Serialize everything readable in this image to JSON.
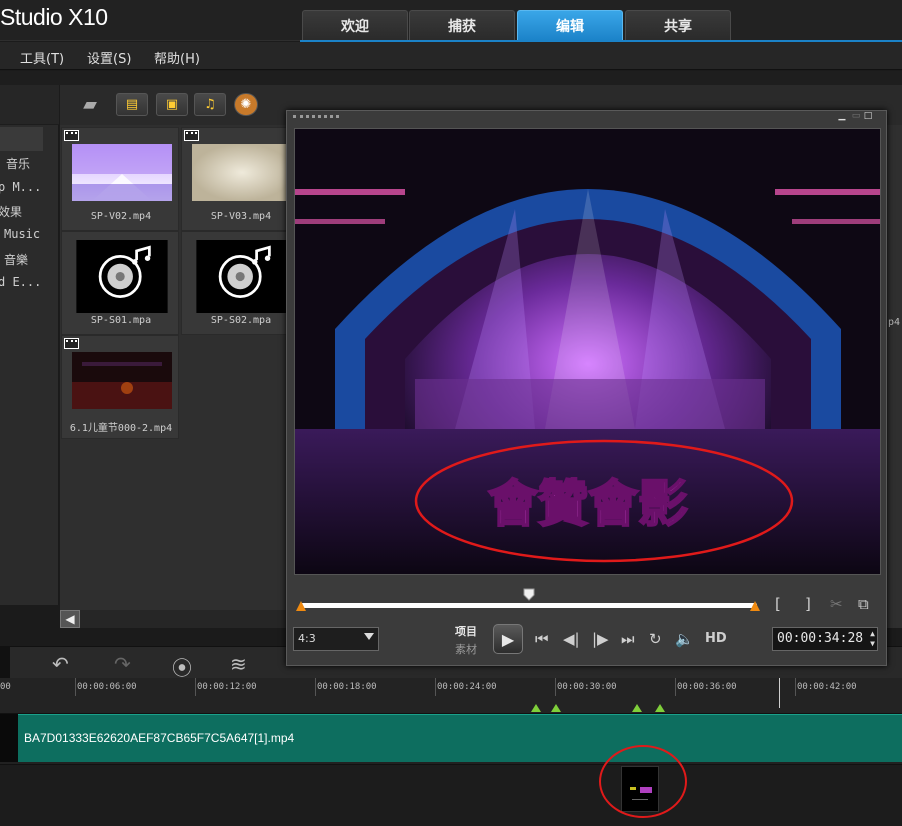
{
  "app": {
    "title": "Studio X10"
  },
  "mode_tabs": [
    {
      "label": "欢迎",
      "active": false
    },
    {
      "label": "捕获",
      "active": false
    },
    {
      "label": "编辑",
      "active": true
    },
    {
      "label": "共享",
      "active": false
    }
  ],
  "menu": [
    {
      "label": "工具(T)"
    },
    {
      "label": "设置(S)"
    },
    {
      "label": "帮助(H)"
    }
  ],
  "categories": [
    {
      "label": "音乐"
    },
    {
      "label": "p M..."
    },
    {
      "label": "效果"
    },
    {
      "label": "Music"
    },
    {
      "label": "音樂"
    },
    {
      "label": "d E..."
    }
  ],
  "library_tiles": [
    {
      "name": "SP-V02.mp4",
      "kind": "video"
    },
    {
      "name": "SP-V03.mp4",
      "kind": "video"
    },
    {
      "name": "SP-S01.mpa",
      "kind": "audio"
    },
    {
      "name": "SP-S02.mpa",
      "kind": "audio"
    },
    {
      "name": "6.1儿童节000-2.mp4",
      "kind": "video"
    }
  ],
  "library_side_label": "p4",
  "preview": {
    "aspect": "4:3",
    "mode_project": "项目",
    "mode_clip": "素材",
    "hd_label": "HD",
    "timecode": "00:00:34:28",
    "scrub_position": 0.5,
    "watermark_text": "會贊會影"
  },
  "ruler_ticks": [
    "00",
    "00:00:06:00",
    "00:00:12:00",
    "00:00:18:00",
    "00:00:24:00",
    "00:00:30:00",
    "00:00:36:00",
    "00:00:42:00"
  ],
  "video_clip": {
    "name": "BA7D01333E62620AEF87CB65F7C5A647[1].mp4",
    "color": "#0d6e5f"
  },
  "accent_color": "#1b82c8",
  "annotation_color": "#e01a1a",
  "icons": [
    "folder-icon",
    "film-icon",
    "image-icon",
    "music-note-icon",
    "effect-icon",
    "undo-icon",
    "redo-icon",
    "record-icon",
    "audio-wave-icon"
  ]
}
